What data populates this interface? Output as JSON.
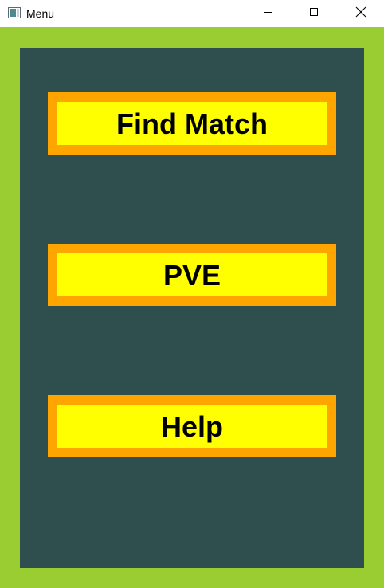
{
  "window": {
    "title": "Menu",
    "controls": {
      "minimize_icon": "minimize-icon",
      "maximize_icon": "maximize-icon",
      "close_icon": "close-icon"
    }
  },
  "colors": {
    "titlebar_bg": "#ffffff",
    "outer_bg": "#9acd32",
    "panel_bg": "#2f4f4f",
    "button_border": "#ffa500",
    "button_fill": "#ffff00",
    "button_text": "#000000"
  },
  "menu": {
    "buttons": [
      {
        "label": "Find Match"
      },
      {
        "label": "PVE"
      },
      {
        "label": "Help"
      }
    ]
  }
}
